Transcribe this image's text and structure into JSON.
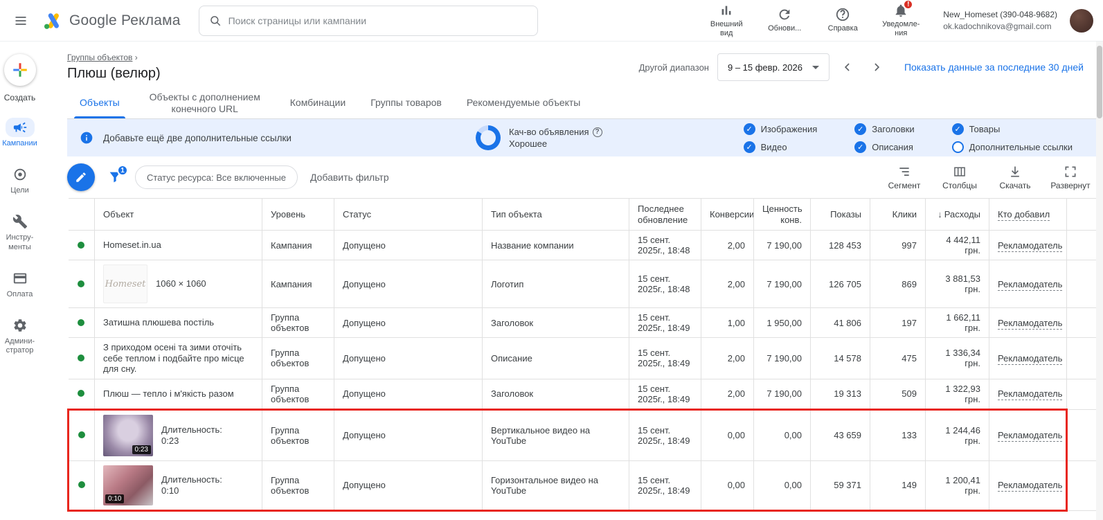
{
  "colors": {
    "accent": "#1a73e8",
    "banner_bg": "#e8f0fe",
    "status_green": "#1e8e3e",
    "highlight_red": "#e8261d",
    "badge_red": "#d93025"
  },
  "glyphs": {
    "question": "?",
    "exclaim": "!",
    "breadcrumb_arrow": "›",
    "sort_down": "↓",
    "check": "✓"
  },
  "topbar": {
    "logo_text": "Google Реклама",
    "search": {
      "placeholder": "Поиск страницы или кампании"
    },
    "actions": [
      {
        "label": "Внешний\nвид"
      },
      {
        "label": "Обнови..."
      },
      {
        "label": "Справка"
      },
      {
        "label": "Уведомле-\nния",
        "badge": "!"
      }
    ],
    "account": {
      "name": "New_Homeset (390-048-9682)",
      "email": "ok.kadochnikova@gmail.com"
    }
  },
  "sidebar": {
    "create_label": "Создать",
    "items": [
      {
        "label": "Кампании",
        "active": true
      },
      {
        "label": "Цели",
        "active": false
      },
      {
        "label": "Инстру-\nменты",
        "active": false
      },
      {
        "label": "Оплата",
        "active": false
      },
      {
        "label": "Админи-\nстратор",
        "active": false
      }
    ]
  },
  "header": {
    "breadcrumb": "Группы объектов",
    "title": "Плюш (велюр)",
    "range_label": "Другой диапазон",
    "date_range": "9 – 15 февр. 2026",
    "show_data_link": "Показать данные за последние 30 дней"
  },
  "tabs": [
    {
      "label": "Объекты",
      "active": true
    },
    {
      "label": "Объекты с дополнением конечного URL",
      "active": false
    },
    {
      "label": "Комбинации",
      "active": false
    },
    {
      "label": "Группы товаров",
      "active": false
    },
    {
      "label": "Рекомендуемые объекты",
      "active": false
    }
  ],
  "banner": {
    "message": "Добавьте ещё две дополнительные ссылки",
    "quality": {
      "label": "Кач-во объявления",
      "value": "Хорошее"
    },
    "checks": [
      {
        "label": "Изображения",
        "checked": true
      },
      {
        "label": "Видео",
        "checked": true
      },
      {
        "label": "Заголовки",
        "checked": true
      },
      {
        "label": "Описания",
        "checked": true
      },
      {
        "label": "Товары",
        "checked": true
      },
      {
        "label": "Дополнительные ссылки",
        "checked": false
      }
    ]
  },
  "toolbar": {
    "filter_badge": "1",
    "status_chip": "Статус ресурса: Все включенные",
    "add_filter_label": "Добавить фильтр",
    "actions": [
      {
        "label": "Сегмент"
      },
      {
        "label": "Столбцы"
      },
      {
        "label": "Скачать"
      },
      {
        "label": "Развернут"
      }
    ]
  },
  "table": {
    "columns": {
      "object": "Объект",
      "level": "Уровень",
      "status": "Статус",
      "type": "Тип объекта",
      "updated": "Последнее обновление",
      "conversions": "Конверсии",
      "conv_value": "Ценность конв.",
      "impressions": "Показы",
      "clicks": "Клики",
      "cost": "Расходы",
      "added_by": "Кто добавил"
    },
    "rows": [
      {
        "object": {
          "kind": "text",
          "text": "Homeset.in.ua"
        },
        "level": "Кампания",
        "status": "Допущено",
        "type": "Название компании",
        "updated": "15 сент. 2025г., 18:48",
        "conversions": "2,00",
        "conv_value": "7 190,00",
        "impressions": "128 453",
        "clicks": "997",
        "cost": "4 442,11 грн.",
        "added_by": "Рекламодатель",
        "highlighted": false
      },
      {
        "object": {
          "kind": "image",
          "style": "logo",
          "thumb_text": "Homeset",
          "caption": "1060 × 1060"
        },
        "level": "Кампания",
        "status": "Допущено",
        "type": "Логотип",
        "updated": "15 сент. 2025г., 18:48",
        "conversions": "2,00",
        "conv_value": "7 190,00",
        "impressions": "126 705",
        "clicks": "869",
        "cost": "3 881,53 грн.",
        "added_by": "Рекламодатель",
        "highlighted": false
      },
      {
        "object": {
          "kind": "text",
          "text": "Затишна плюшева постіль"
        },
        "level": "Группа объектов",
        "status": "Допущено",
        "type": "Заголовок",
        "updated": "15 сент. 2025г., 18:49",
        "conversions": "1,00",
        "conv_value": "1 950,00",
        "impressions": "41 806",
        "clicks": "197",
        "cost": "1 662,11 грн.",
        "added_by": "Рекламодатель",
        "highlighted": false
      },
      {
        "object": {
          "kind": "text",
          "text": "З приходом осені та зими оточіть себе теплом і подбайте про місце для сну."
        },
        "level": "Группа объектов",
        "status": "Допущено",
        "type": "Описание",
        "updated": "15 сент. 2025г., 18:49",
        "conversions": "2,00",
        "conv_value": "7 190,00",
        "impressions": "14 578",
        "clicks": "475",
        "cost": "1 336,34 грн.",
        "added_by": "Рекламодатель",
        "highlighted": false
      },
      {
        "object": {
          "kind": "text",
          "text": "Плюш — тепло і м'якість разом"
        },
        "level": "Группа объектов",
        "status": "Допущено",
        "type": "Заголовок",
        "updated": "15 сент. 2025г., 18:49",
        "conversions": "2,00",
        "conv_value": "7 190,00",
        "impressions": "19 313",
        "clicks": "509",
        "cost": "1 322,93 грн.",
        "added_by": "Рекламодатель",
        "highlighted": false
      },
      {
        "object": {
          "kind": "video",
          "style": "vertical",
          "duration": "0:23",
          "caption": "Длительность:\n0:23"
        },
        "level": "Группа объектов",
        "status": "Допущено",
        "type": "Вертикальное видео на YouTube",
        "updated": "15 сент. 2025г., 18:49",
        "conversions": "0,00",
        "conv_value": "0,00",
        "impressions": "43 659",
        "clicks": "133",
        "cost": "1 244,46 грн.",
        "added_by": "Рекламодатель",
        "highlighted": true
      },
      {
        "object": {
          "kind": "video",
          "style": "horizontal",
          "duration": "0:10",
          "caption": "Длительность:\n0:10"
        },
        "level": "Группа объектов",
        "status": "Допущено",
        "type": "Горизонтальное видео на YouTube",
        "updated": "15 сент. 2025г., 18:49",
        "conversions": "0,00",
        "conv_value": "0,00",
        "impressions": "59 371",
        "clicks": "149",
        "cost": "1 200,41 грн.",
        "added_by": "Рекламодатель",
        "highlighted": true
      }
    ]
  }
}
